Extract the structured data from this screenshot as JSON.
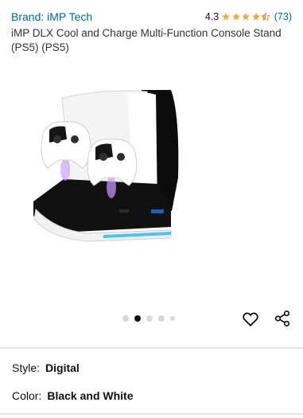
{
  "brand": {
    "label": "Brand: iMP Tech"
  },
  "rating": {
    "value": "4.3",
    "count": "(73)",
    "stars": 4.3
  },
  "product": {
    "title": "iMP DLX Cool and Charge Multi-Function Console Stand (PS5) (PS5)",
    "image_alt": "Console charging stand with two controllers"
  },
  "carousel": {
    "total": 5,
    "active_index": 1
  },
  "actions": {
    "wishlist_icon": "heart-icon",
    "share_icon": "share-icon"
  },
  "variations": {
    "style": {
      "label": "Style:",
      "value": "Digital"
    },
    "color": {
      "label": "Color:",
      "value": "Black and White"
    }
  },
  "colors": {
    "link": "#007185",
    "star": "#f3a847"
  }
}
